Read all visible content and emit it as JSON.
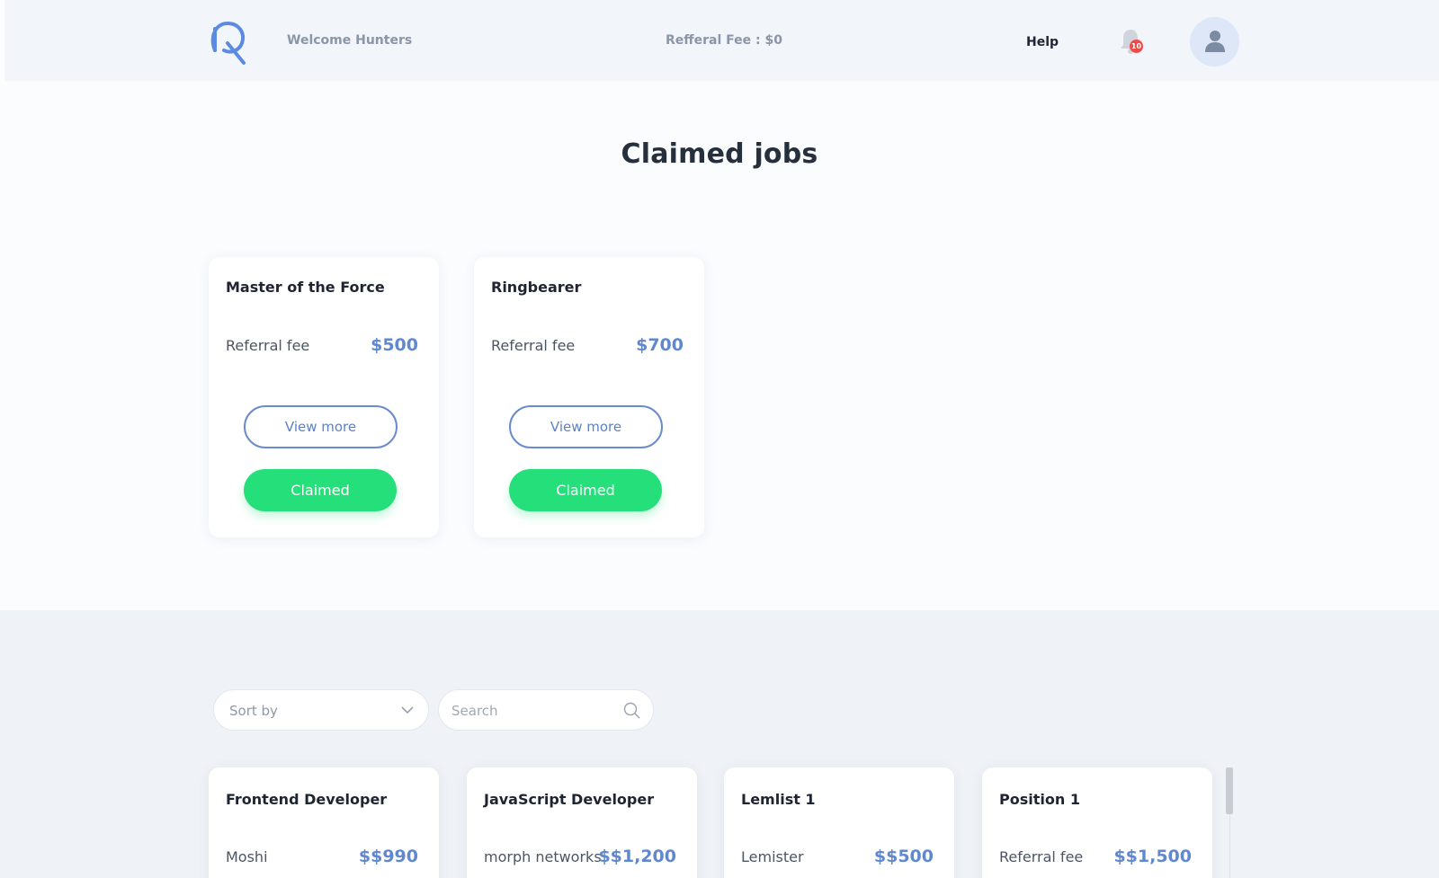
{
  "header": {
    "welcome": "Welcome Hunters",
    "referral_fee": "Refferal Fee : $0",
    "help": "Help",
    "notification_count": "10"
  },
  "page_title": "Claimed jobs",
  "claimed_cards": [
    {
      "title": "Master of the Force",
      "label": "Referral fee",
      "fee": "$500",
      "view_more": "View more",
      "status": "Claimed"
    },
    {
      "title": "Ringbearer",
      "label": "Referral fee",
      "fee": "$700",
      "view_more": "View more",
      "status": "Claimed"
    }
  ],
  "filters": {
    "sort_by": "Sort by",
    "search_placeholder": "Search"
  },
  "job_cards": [
    {
      "title": "Frontend Developer",
      "label": "Moshi",
      "fee": "$$990"
    },
    {
      "title": "JavaScript Developer",
      "label": "morph networks",
      "fee": "$$1,200"
    },
    {
      "title": "Lemlist 1",
      "label": "Lemister",
      "fee": "$$500"
    },
    {
      "title": "Position 1",
      "label": "Referral fee",
      "fee": "$$1,500"
    }
  ],
  "colors": {
    "accent_blue": "#6088cf",
    "claimed_green": "#25e07a",
    "badge_red": "#ee4a4a"
  }
}
